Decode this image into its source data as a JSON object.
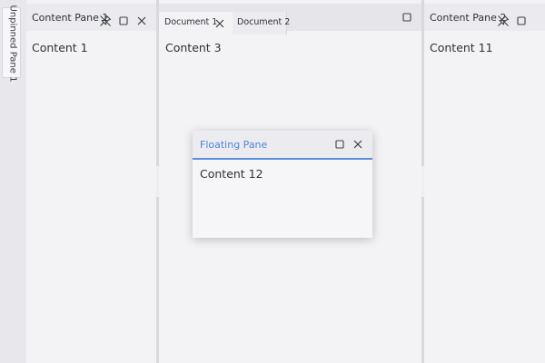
{
  "side_strip": {
    "unpinned_tab_label": "Unpinned Pane 1"
  },
  "left_pane": {
    "title": "Content Pane 1",
    "content": "Content 1",
    "pin_icon": "pin-off-icon",
    "maximize_icon": "maximize-icon",
    "close_icon": "close-icon"
  },
  "document_area": {
    "tabs": [
      {
        "label": "Document 1",
        "active": true,
        "close_icon": "close-icon"
      },
      {
        "label": "Document 2",
        "active": false
      }
    ],
    "maximize_icon": "maximize-icon",
    "content": "Content 3"
  },
  "right_pane": {
    "title": "Content Pane 2",
    "content": "Content 11",
    "pin_icon": "pin-off-icon",
    "maximize_icon": "maximize-icon"
  },
  "floating_pane": {
    "title": "Floating Pane",
    "content": "Content 12",
    "maximize_icon": "maximize-icon",
    "close_icon": "close-icon"
  },
  "colors": {
    "accent": "#4a85d6",
    "background": "#e3e4e8",
    "pane": "#f3f3f6",
    "header": "#ebebef"
  }
}
